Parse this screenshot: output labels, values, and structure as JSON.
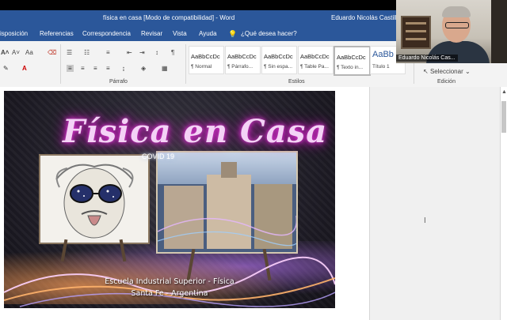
{
  "window": {
    "title": "física en casa [Modo de compatibilidad]  -  Word",
    "user": "Eduardo Nicolás Castillo"
  },
  "menu": {
    "items": [
      "isposición",
      "Referencias",
      "Correspondencia",
      "Revisar",
      "Vista",
      "Ayuda"
    ],
    "tell_me": "¿Qué desea hacer?"
  },
  "ribbon": {
    "font_size_label": "Aa",
    "group_paragraph": "Párrafo",
    "group_styles": "Estilos",
    "group_edit": "Edición",
    "select_label": "Seleccionar",
    "styles": [
      {
        "sample": "AaBbCcDc",
        "name": "¶ Normal"
      },
      {
        "sample": "AaBbCcDc",
        "name": "¶ Párrafo..."
      },
      {
        "sample": "AaBbCcDc",
        "name": "¶ Sin espa..."
      },
      {
        "sample": "AaBbCcDc",
        "name": "¶ Table Pa..."
      },
      {
        "sample": "AaBbCcDc",
        "name": "¶ Texto in..."
      },
      {
        "sample": "AaBb",
        "name": "Título 1"
      }
    ]
  },
  "webcam": {
    "name": "Eduardo Nicolás Cas..."
  },
  "cover": {
    "title": "Física en Casa",
    "subtitle": "COVID 19",
    "line1": "Escuela Industrial Superior - Física",
    "line2": "Santa Fe - Argentina"
  },
  "colors": {
    "word_blue": "#2b579a",
    "neon_pink": "#e23ad6"
  }
}
